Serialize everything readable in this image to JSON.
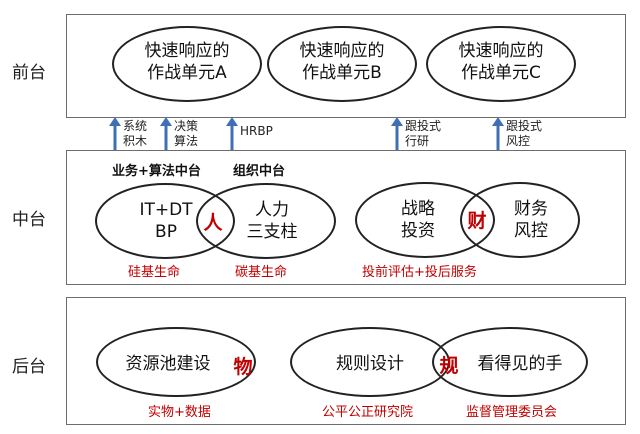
{
  "rows": {
    "front": "前台",
    "middle": "中台",
    "back": "后台"
  },
  "front_units": [
    {
      "line1": "快速响应的",
      "line2": "作战单元A"
    },
    {
      "line1": "快速响应的",
      "line2": "作战单元B"
    },
    {
      "line1": "快速响应的",
      "line2": "作战单元C"
    }
  ],
  "arrows": [
    {
      "line1": "系统",
      "line2": "积木"
    },
    {
      "line1": "决策",
      "line2": "算法"
    },
    {
      "line1": "HRBP",
      "line2": ""
    },
    {
      "line1": "跟投式",
      "line2": "行研"
    },
    {
      "line1": "跟投式",
      "line2": "风控"
    }
  ],
  "middle": {
    "heading_left": "业务+算法中台",
    "heading_right": "组织中台",
    "left_oval": {
      "line1": "IT+DT",
      "line2": "BP"
    },
    "left_key": "人",
    "left_oval2": {
      "line1": "人力",
      "line2": "三支柱"
    },
    "right_oval": {
      "line1": "战略",
      "line2": "投资"
    },
    "right_key": "财",
    "right_oval2": {
      "line1": "财务",
      "line2": "风控"
    },
    "label_silicon": "硅基生命",
    "label_carbon": "碳基生命",
    "label_invest": "投前评估+投后服务"
  },
  "back": {
    "left_oval": "资源池建设",
    "left_key": "物",
    "right_oval": "规则设计",
    "right_key": "规",
    "right_oval2": "看得见的手",
    "label_material": "实物+数据",
    "label_institute": "公平公正研究院",
    "label_committee": "监督管理委员会"
  },
  "colors": {
    "accent_red": "#c00000",
    "arrow_blue": "#3f6fb5",
    "border": "#6d6d6d"
  }
}
